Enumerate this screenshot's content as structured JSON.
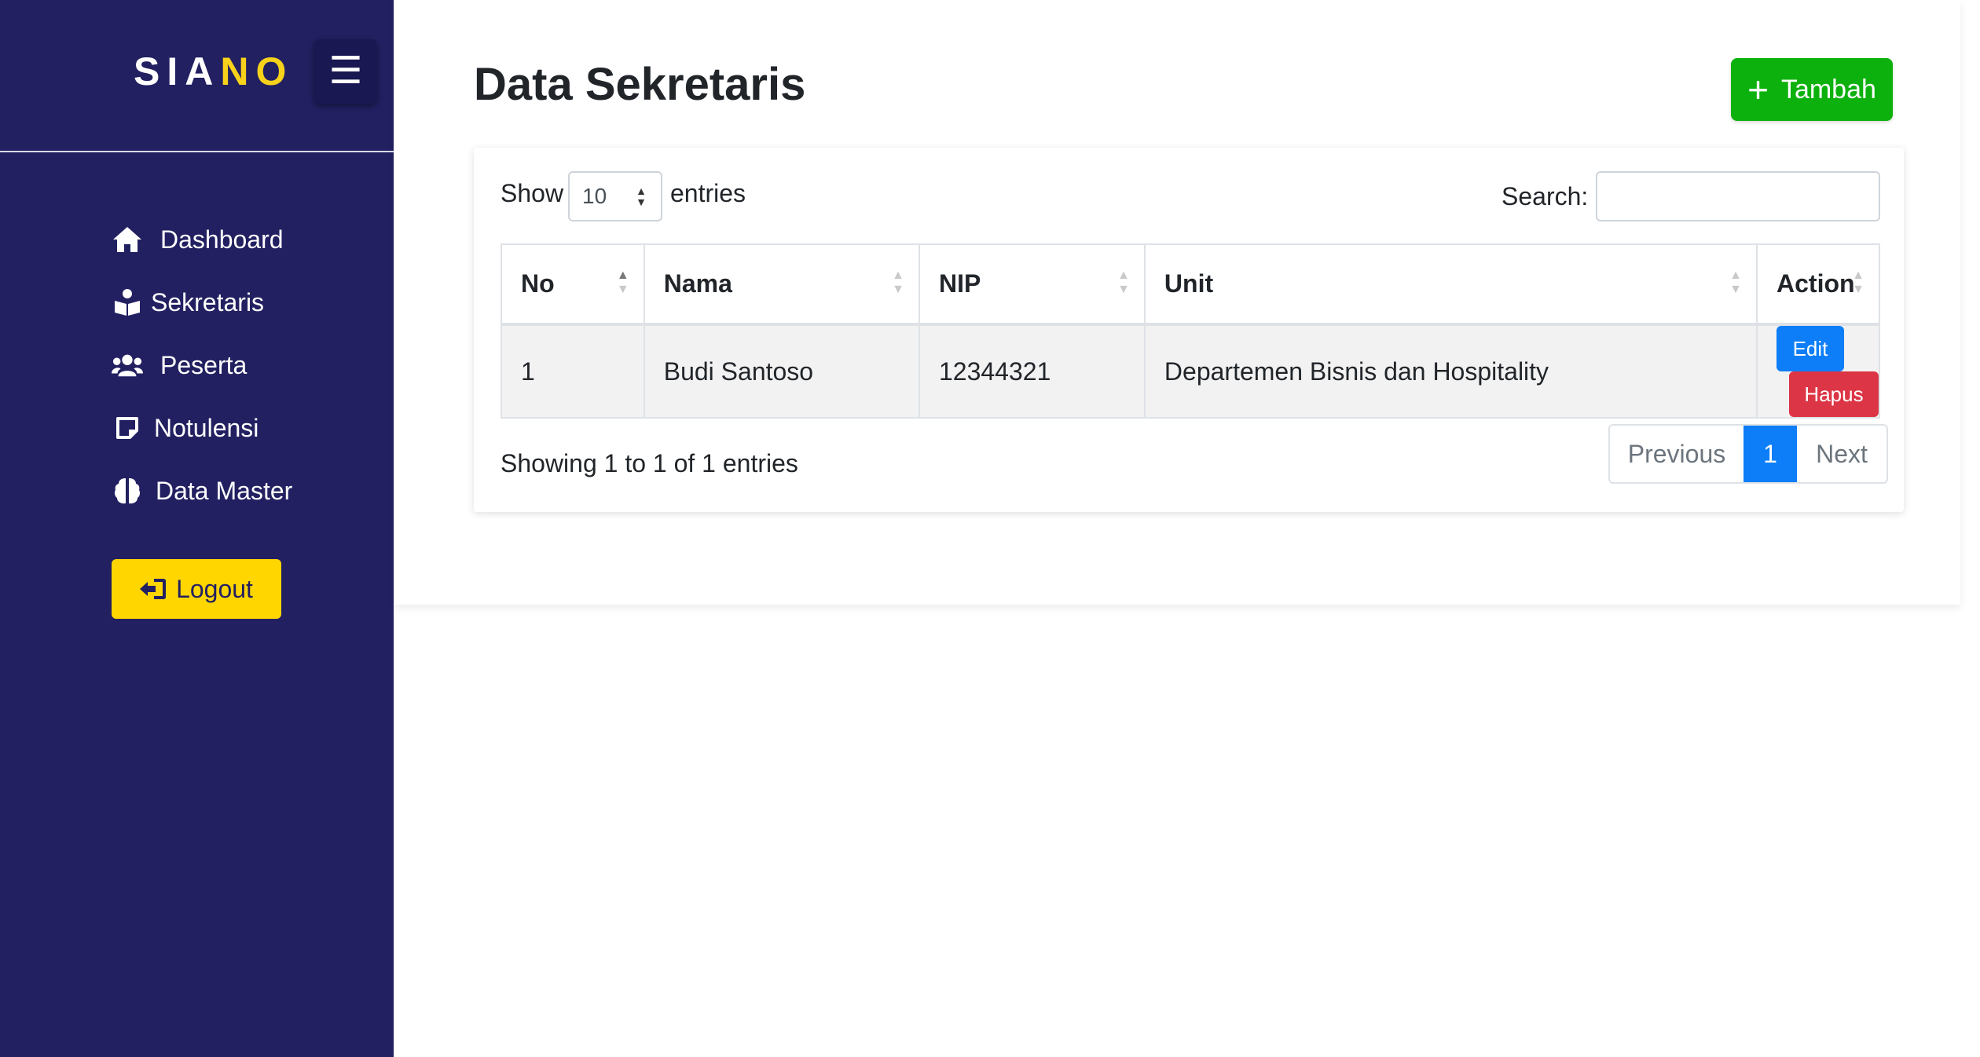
{
  "sidebar": {
    "brand_main": "SIA",
    "brand_accent": "NO",
    "items": [
      {
        "label": "Dashboard"
      },
      {
        "label": "Sekretaris"
      },
      {
        "label": "Peserta"
      },
      {
        "label": "Notulensi"
      },
      {
        "label": "Data Master"
      }
    ],
    "logout_label": "Logout",
    "colors": {
      "background": "#222061",
      "accent": "#f7d21a",
      "logout": "#ffd600"
    }
  },
  "header": {
    "title": "Data Sekretaris",
    "add_label": "Tambah"
  },
  "table_controls": {
    "show_label": "Show",
    "entries_per_page": "10",
    "entries_label": "entries",
    "search_label": "Search:",
    "search_value": ""
  },
  "table": {
    "columns": [
      "No",
      "Nama",
      "NIP",
      "Unit",
      "Action"
    ],
    "rows": [
      {
        "no": "1",
        "nama": "Budi Santoso",
        "nip": "12344321",
        "unit": "Departemen Bisnis dan Hospitality"
      }
    ],
    "action_edit": "Edit",
    "action_delete": "Hapus"
  },
  "footer": {
    "info": "Showing 1 to 1 of 1 entries",
    "prev": "Previous",
    "current_page": "1",
    "next": "Next"
  }
}
